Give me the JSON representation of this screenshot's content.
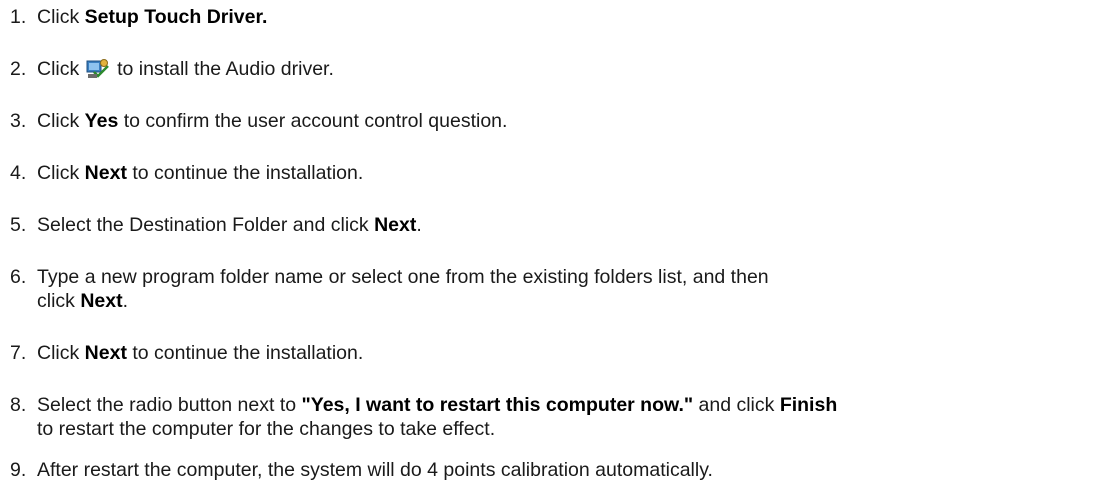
{
  "steps": [
    {
      "num": "1.",
      "pre": "Click ",
      "bold": "Setup Touch Driver."
    },
    {
      "num": "2.",
      "pre": "Click ",
      "post": " to install the Audio driver.",
      "icon": "audio-driver-setup-icon"
    },
    {
      "num": "3.",
      "pre": "Click ",
      "bold": "Yes",
      "post": " to confirm the user account control question."
    },
    {
      "num": "4.",
      "pre": "Click ",
      "bold": "Next",
      "post": " to continue the installation."
    },
    {
      "num": "5.",
      "pre": "Select the Destination Folder and click ",
      "bold": "Next",
      "post": "."
    },
    {
      "num": "6.",
      "pre": "Type a new program folder name or select one from the existing folders list, and then",
      "cont_pre": "click ",
      "cont_bold": "Next",
      "cont_post": "."
    },
    {
      "num": "7.",
      "pre": "Click ",
      "bold": "Next",
      "post": " to continue the installation."
    },
    {
      "num": "8.",
      "pre": "Select the radio button next to ",
      "bold": "\"Yes, I want to restart this computer now.\"",
      "mid": " and click ",
      "bold2": "Finish",
      "cont_pre": "to restart the computer for the changes to take effect."
    },
    {
      "num": "9.",
      "pre": "After restart the computer, the system will do 4 points calibration automatically."
    }
  ]
}
